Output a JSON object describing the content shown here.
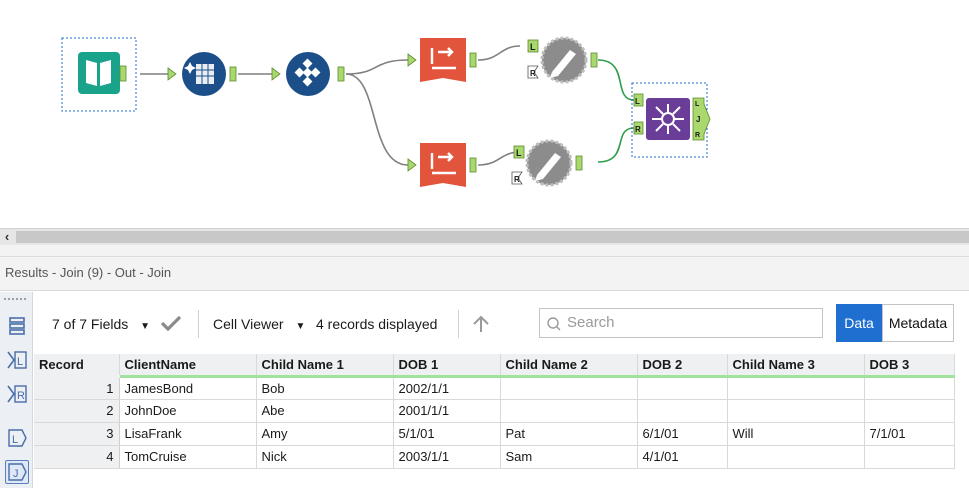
{
  "canvas": {
    "tools": [
      {
        "name": "input-data-tool",
        "icon": "book-icon",
        "color": "#1aa38b"
      },
      {
        "name": "data-cleansing-tool",
        "icon": "sparkle-grid-icon",
        "color": "#1c4f8a"
      },
      {
        "name": "select-tool",
        "icon": "diamond-grid-icon",
        "color": "#1c4f8a"
      },
      {
        "name": "crosstab-tool-top",
        "icon": "crosstab-icon",
        "color": "#e2553c"
      },
      {
        "name": "crosstab-tool-bottom",
        "icon": "crosstab-icon",
        "color": "#e2553c"
      },
      {
        "name": "dynamic-rename-tool-top",
        "icon": "pencil-gear-icon",
        "color": "#8c8c8c"
      },
      {
        "name": "dynamic-rename-tool-bottom",
        "icon": "pencil-gear-icon",
        "color": "#8c8c8c"
      },
      {
        "name": "join-tool",
        "icon": "join-icon",
        "color": "#6a3d99"
      }
    ],
    "anchor_labels": {
      "left": "L",
      "right": "R",
      "join": "J"
    }
  },
  "results": {
    "title": "Results - Join (9) - Out - Join"
  },
  "toolbar": {
    "fields_label": "7 of 7 Fields",
    "cell_viewer_label": "Cell Viewer",
    "records_label": "4 records displayed",
    "search_placeholder": "Search",
    "data_button": "Data",
    "metadata_button": "Metadata"
  },
  "side_buttons": [
    {
      "name": "all-rows-icon",
      "label": ""
    },
    {
      "name": "left-output-icon",
      "label": "L"
    },
    {
      "name": "right-output-icon",
      "label": "R"
    },
    {
      "name": "left-anchor-icon",
      "label": "L"
    },
    {
      "name": "join-anchor-icon",
      "label": "J"
    }
  ],
  "table": {
    "columns": [
      "Record",
      "ClientName",
      "Child Name 1",
      "DOB 1",
      "Child Name 2",
      "DOB 2",
      "Child Name 3",
      "DOB 3"
    ],
    "rows": [
      [
        "1",
        "JamesBond",
        "Bob",
        "2002/1/1",
        "",
        "",
        "",
        ""
      ],
      [
        "2",
        "JohnDoe",
        "Abe",
        "2001/1/1",
        "",
        "",
        "",
        ""
      ],
      [
        "3",
        "LisaFrank",
        "Amy",
        "5/1/01",
        "Pat",
        "6/1/01",
        "Will",
        "7/1/01"
      ],
      [
        "4",
        "TomCruise",
        "Nick",
        "2003/1/1",
        "Sam",
        "4/1/01",
        "",
        ""
      ]
    ]
  },
  "colors": {
    "accent": "#1e6fd0",
    "anchor_green": "#a9d86e",
    "connection_active": "#2e9e4a",
    "connection_gray": "#7f7f7f",
    "header_underline": "#9fe39f"
  }
}
